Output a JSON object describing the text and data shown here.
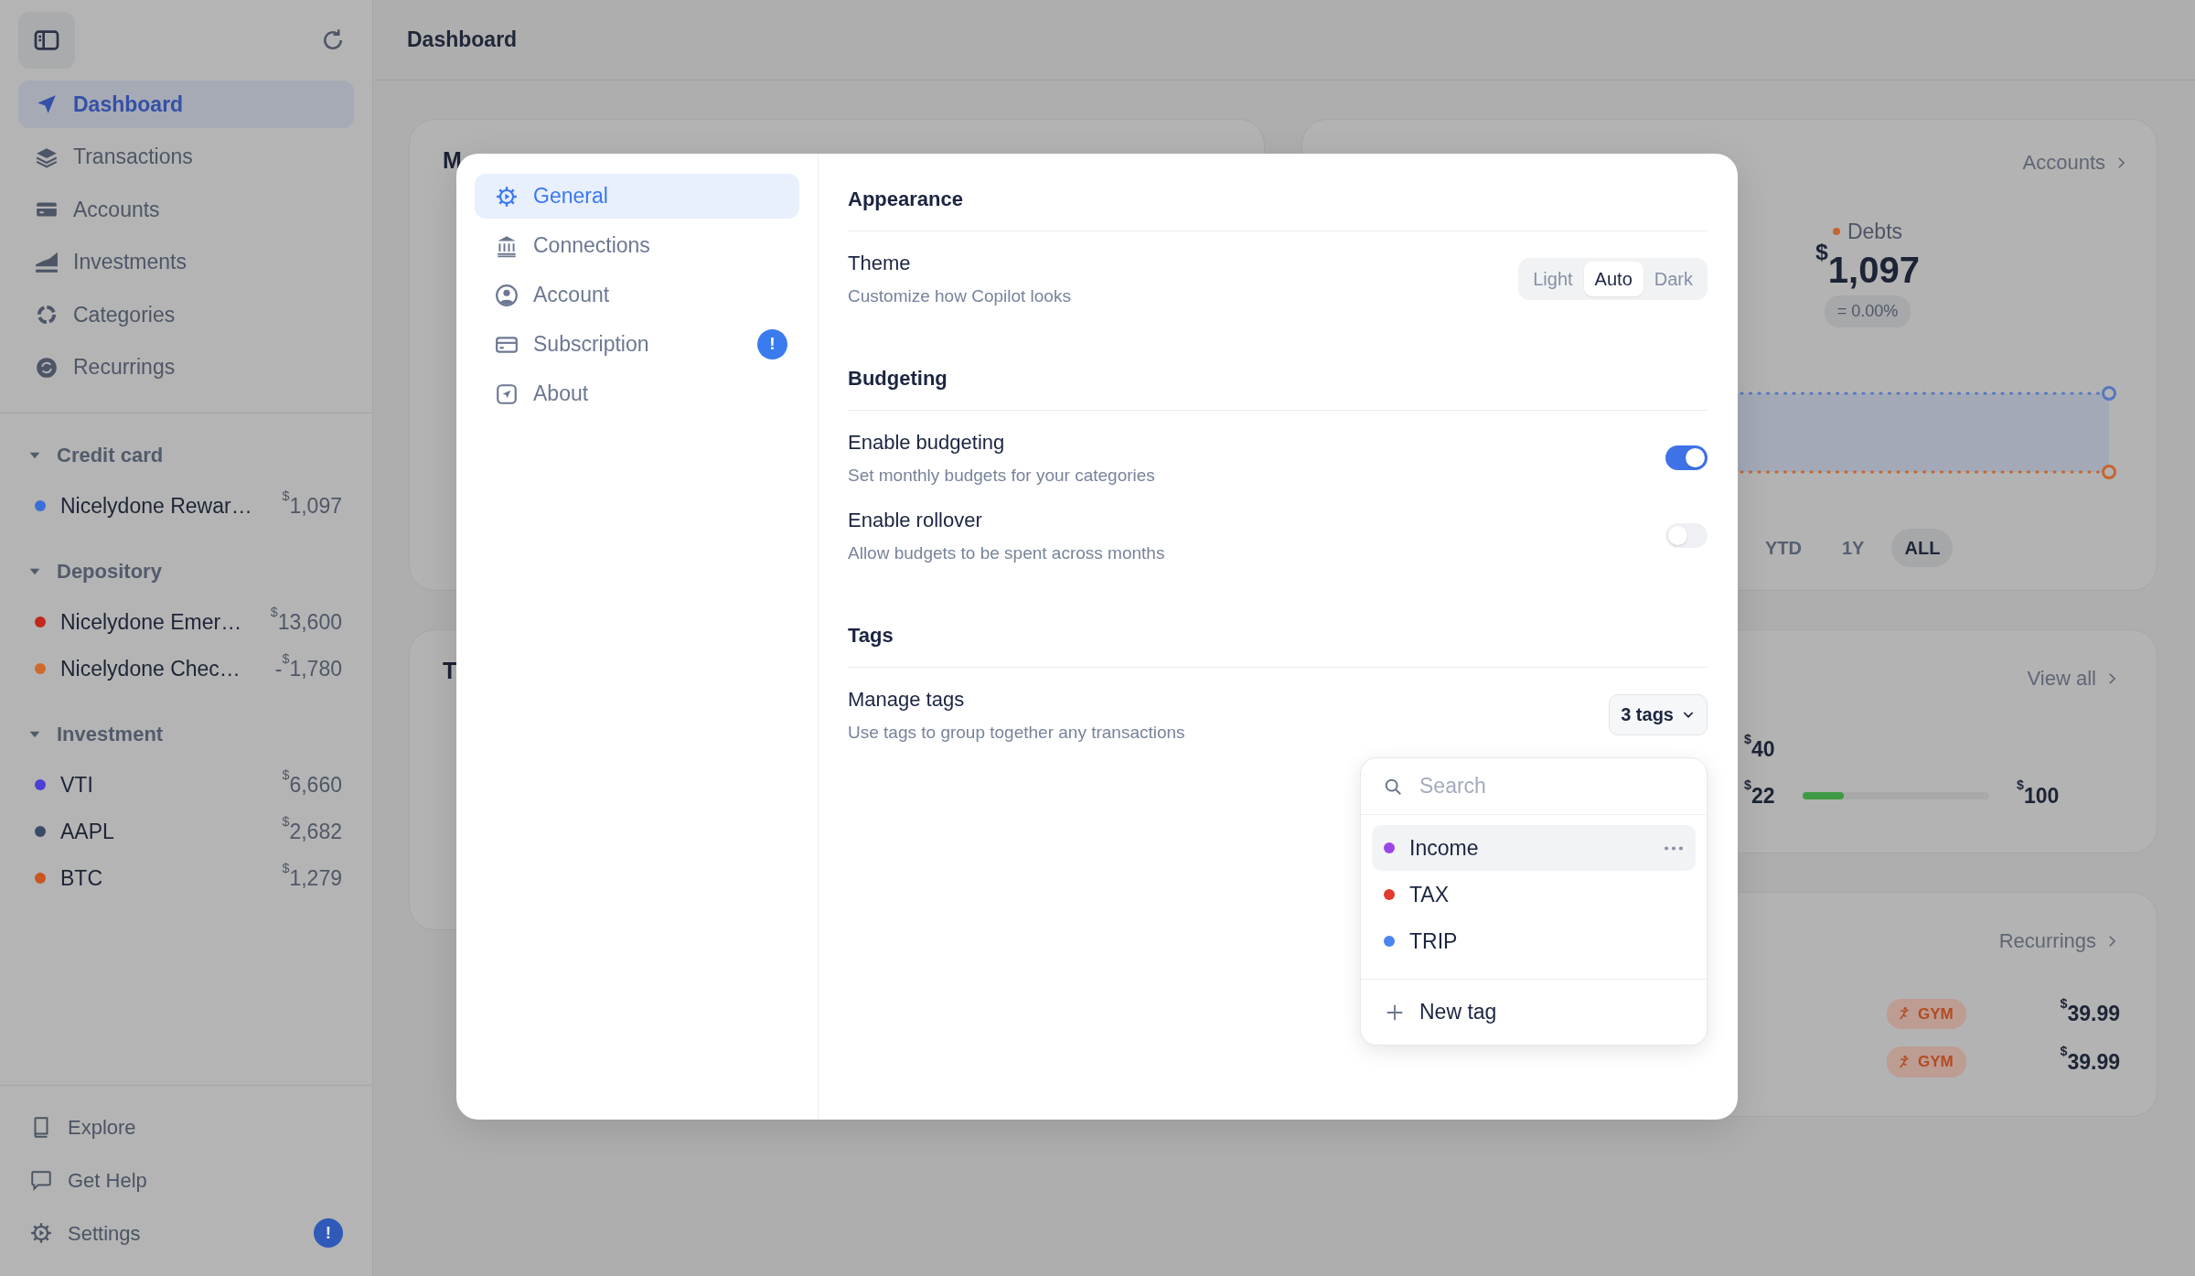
{
  "sidebar": {
    "nav": [
      {
        "label": "Dashboard",
        "selected": true
      },
      {
        "label": "Transactions",
        "selected": false
      },
      {
        "label": "Accounts",
        "selected": false
      },
      {
        "label": "Investments",
        "selected": false
      },
      {
        "label": "Categories",
        "selected": false
      },
      {
        "label": "Recurrings",
        "selected": false
      }
    ],
    "groups": [
      {
        "title": "Credit card",
        "expanded": true,
        "accounts": [
          {
            "name": "Nicelydone Rewar…",
            "amount": "$^{$}$1,097",
            "color": "#3a6fd8"
          }
        ]
      },
      {
        "title": "Depository",
        "expanded": true,
        "accounts": [
          {
            "name": "Nicelydone Emer…",
            "amount": "$^{$}$13,600",
            "color": "#c2281c"
          },
          {
            "name": "Nicelydone Chec…",
            "amount": "-$^{$}$1,780",
            "color": "#cf6a2a"
          }
        ]
      },
      {
        "title": "Investment",
        "expanded": true,
        "accounts": [
          {
            "name": "VTI",
            "amount": "$^{$}$6,660",
            "color": "#4b3fd6"
          },
          {
            "name": "AAPL",
            "amount": "$^{$}$2,682",
            "color": "#3b4a66"
          },
          {
            "name": "BTC",
            "amount": "$^{$}$1,279",
            "color": "#c8561f"
          }
        ]
      }
    ],
    "footer": [
      {
        "label": "Explore"
      },
      {
        "label": "Get Help"
      },
      {
        "label": "Settings",
        "badge": "!"
      }
    ]
  },
  "header": {
    "title": "Dashboard"
  },
  "left_cards": [
    {
      "title": "M"
    },
    {
      "title": "T"
    }
  ],
  "accounts_card": {
    "link": "Accounts",
    "legend": "Debts",
    "value": "$^{$}$1,097",
    "change": "= 0.00%",
    "ranges": [
      {
        "label": "YTD",
        "selected": false
      },
      {
        "label": "1Y",
        "selected": false
      },
      {
        "label": "ALL",
        "selected": true
      }
    ]
  },
  "budget_card": {
    "link": "View all",
    "rows": [
      {
        "spent": "$^{$}$40"
      },
      {
        "spent": "$^{$}$22",
        "level": 0.22,
        "limit": "$^{$}$100"
      }
    ]
  },
  "recurrings_card": {
    "link": "Recurrings",
    "rows": [
      {
        "tag": "GYM",
        "amount": "$^{$}$39.99"
      },
      {
        "tag": "GYM",
        "amount": "$^{$}$39.99"
      }
    ]
  },
  "settings": {
    "nav": [
      {
        "label": "General",
        "selected": true
      },
      {
        "label": "Connections",
        "selected": false
      },
      {
        "label": "Account",
        "selected": false
      },
      {
        "label": "Subscription",
        "selected": false,
        "badge": "!"
      },
      {
        "label": "About",
        "selected": false
      }
    ],
    "sections": [
      {
        "title": "Appearance",
        "rows": [
          {
            "kind": "segmented",
            "label": "Theme",
            "description": "Customize how Copilot looks",
            "options": [
              {
                "label": "Light",
                "selected": false
              },
              {
                "label": "Auto",
                "selected": true
              },
              {
                "label": "Dark",
                "selected": false
              }
            ]
          }
        ]
      },
      {
        "title": "Budgeting",
        "rows": [
          {
            "kind": "switch",
            "label": "Enable budgeting",
            "description": "Set monthly budgets for your categories",
            "on": true
          },
          {
            "kind": "switch",
            "label": "Enable rollover",
            "description": "Allow budgets to be spent across months",
            "on": false
          }
        ]
      },
      {
        "title": "Tags",
        "rows": [
          {
            "kind": "dropdown",
            "label": "Manage tags",
            "description": "Use tags to group together any transactions",
            "button": "3 tags"
          }
        ]
      }
    ]
  },
  "tag_menu": {
    "placeholder": "Search",
    "tags": [
      {
        "name": "Income",
        "color": "#9b45e8",
        "selected": true
      },
      {
        "name": "TAX",
        "color": "#e23b2e",
        "selected": false
      },
      {
        "name": "TRIP",
        "color": "#4a86f0",
        "selected": false
      }
    ],
    "new_tag": "New tag"
  }
}
